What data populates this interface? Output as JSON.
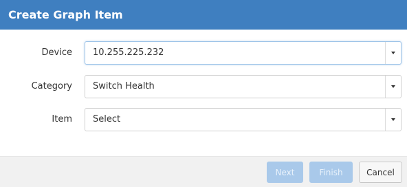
{
  "dialog": {
    "title": "Create Graph Item"
  },
  "fields": {
    "device": {
      "label": "Device",
      "value": "10.255.225.232"
    },
    "category": {
      "label": "Category",
      "value": "Switch Health"
    },
    "item": {
      "label": "Item",
      "value": "Select"
    }
  },
  "buttons": {
    "next": "Next",
    "finish": "Finish",
    "cancel": "Cancel"
  },
  "colors": {
    "header": "#3f7fc0",
    "disabled_button": "#a9c9ea"
  },
  "icons": {
    "dropdown": "caret-down-icon"
  }
}
